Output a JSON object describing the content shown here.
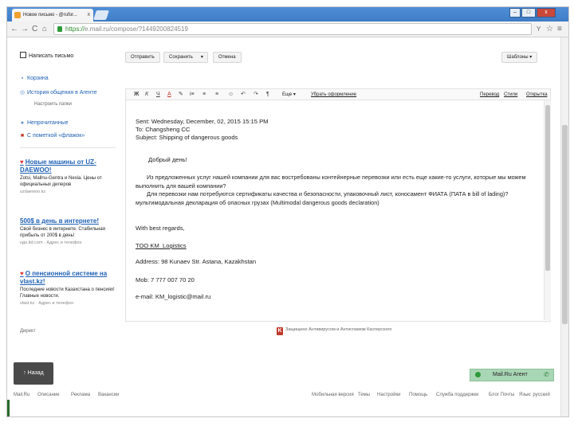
{
  "browser": {
    "tab_title": "Новое письмо - @rufor...",
    "tab_close": "x",
    "url_secure": "https://",
    "url_rest": "e.mail.ru/compose/?1449200824519",
    "win_min": "–",
    "win_max": "□",
    "win_close": "x",
    "back": "←",
    "forward": "→",
    "reload": "C",
    "home": "⌂",
    "ext_icon": "Y",
    "star": "☆",
    "menu": "≡"
  },
  "sidebar": {
    "compose_label": "Написать письмо",
    "folders": [
      {
        "label": "Корзина",
        "icon": "bin-icon"
      },
      {
        "label": "История общения в Агенте",
        "icon": "agent-history-icon"
      }
    ],
    "settings_link": "Настроить папки",
    "folders2": [
      {
        "label": "Непрочитанные",
        "icon": "unread-icon"
      },
      {
        "label": "С пометкой «флажок»",
        "icon": "flag-icon"
      }
    ],
    "ads": [
      {
        "title": "Новые машины от UZ-DAEWOO!",
        "text": "Zotsi, Mallnu-Gentra и Nexia. Цены от официальных дилеров",
        "source": "uzdaewoo.kz"
      },
      {
        "title": "500$ в день в интернете!",
        "text": "Свой бизнес в интернете. Стабильная прибыль от 200$ в день!",
        "source": "ндн.ltd.com · Адрес и телефон"
      },
      {
        "title": "О пенсионной системе на vlast.kz!",
        "text": "Последние новости Казахстана о пенсиях! Главные новости.",
        "source": "vlast.kz · Адрес и телефон"
      }
    ],
    "ad_more": "Директ"
  },
  "toolbar": {
    "send": "Отправить",
    "save": "Сохранить",
    "save_caret": "▾",
    "cancel": "Отмена",
    "templates": "Шаблоны ▾"
  },
  "editor_toolbar": {
    "icons": [
      "Ж",
      "К",
      "Ч",
      "A",
      "✎",
      "i≡",
      "≡",
      "≡",
      "☺",
      "↶",
      "↷",
      "¶"
    ],
    "more": "Еще ▾",
    "remove_format": "Убрать оформление",
    "spelling": "Перевод",
    "signature": "Стили",
    "plaintext": "Открытка"
  },
  "message": {
    "sent": "Sent: Wednesday, December, 02, 2015 15:15 PM",
    "to": "To: Changsheng CC",
    "subject": "Subject: Shipping of dangerous goods",
    "greeting": "Добрый день!",
    "para1": "Из предложенных услуг нашей компании для вас востребованы контейнерные перевозки или есть еще какие-то услуги, которые мы можем выполнить для вашей компании?",
    "para2": "Для перевозки нам потребуются сертификаты качества и безопасности, упаковочный лист, коносамент ФИАТА (ПАТА в bill of lading)? мультимодальная декларация об опасных грузах (Multimodal dangerous goods declaration)",
    "regards": "With best regards,",
    "company": "TOO KM_Logistics",
    "address": "Address: 98 Kunaev Str. Astana, Kazakhstan",
    "mob": "Mob: 7 777 007 70 20",
    "email": "e-mail: KM_logistic@mail.ru"
  },
  "footer": {
    "kaspersky": "Защищено Антивирусом и Антиспамом Касперского",
    "back_button": "↑ Назад",
    "agent": "Mail.Ru Агент",
    "links_left": [
      "Mail.Ru",
      "Описание",
      "Реклама",
      "Вакансии"
    ],
    "links_right": [
      "Мобильная версия",
      "Темы",
      "Настройки",
      "Помощь",
      "Служба поддержки",
      "Блог Почты",
      "Язык: русский"
    ]
  }
}
